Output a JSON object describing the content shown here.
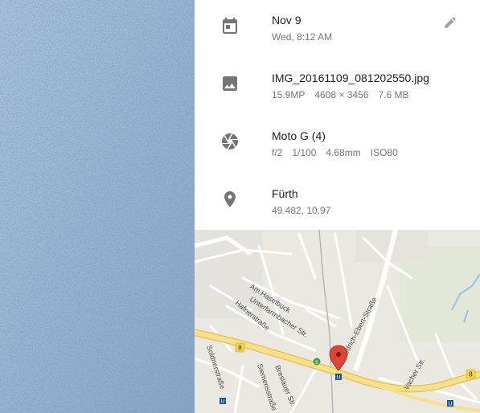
{
  "details": {
    "date": {
      "title": "Nov 9",
      "subtitle": "Wed, 8:12 AM",
      "icon": "calendar-icon",
      "edit_icon": "pencil-icon"
    },
    "file": {
      "title": "IMG_20161109_081202550.jpg",
      "megapixels": "15.9MP",
      "resolution": "4608 × 3456",
      "size": "7.6 MB",
      "icon": "image-icon"
    },
    "camera": {
      "title": "Moto G (4)",
      "aperture": "f/2",
      "shutter": "1/100",
      "focal_length": "4.68mm",
      "iso": "ISO80",
      "icon": "aperture-icon"
    },
    "location": {
      "title": "Fürth",
      "coordinates": "49.482, 10.97",
      "icon": "location-pin-icon"
    }
  },
  "map": {
    "streets": [
      "Am Haselbuck",
      "Unterfarrnbacher Str.",
      "Hafnerstraße",
      "Friedrich-Ebert-Straße",
      "Vacher Str.",
      "Soldnerstraße",
      "Siemensstraße",
      "Breslauer Str."
    ],
    "route_badge": "8",
    "sbahn_badge": "S",
    "ubahn_badge": "U"
  },
  "colors": {
    "accent_pin": "#db4437",
    "icon_grey": "#757575",
    "photo_blue": "#97b5d6",
    "road_yellow": "#f6e08a"
  }
}
